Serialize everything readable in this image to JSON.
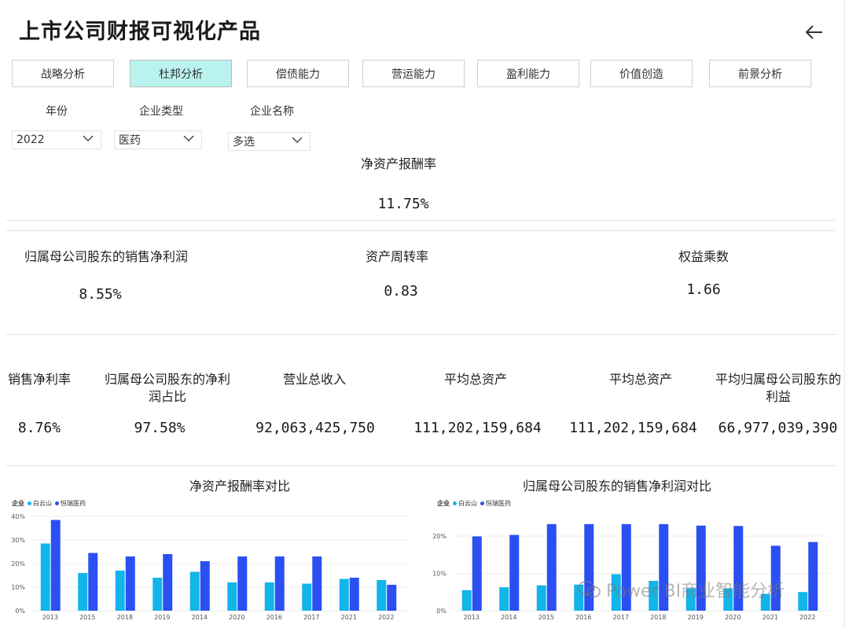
{
  "app": {
    "title": "上市公司财报可视化产品"
  },
  "tabs": [
    {
      "label": "战略分析",
      "active": false
    },
    {
      "label": "杜邦分析",
      "active": true
    },
    {
      "label": "偿债能力",
      "active": false
    },
    {
      "label": "营运能力",
      "active": false
    },
    {
      "label": "盈利能力",
      "active": false
    },
    {
      "label": "价值创造",
      "active": false
    },
    {
      "label": "前景分析",
      "active": false
    }
  ],
  "filters": {
    "year": {
      "label": "年份",
      "value": "2022"
    },
    "type": {
      "label": "企业类型",
      "value": "医药"
    },
    "name": {
      "label": "企业名称",
      "value": "多选"
    }
  },
  "kpis": {
    "roe": {
      "label": "净资产报酬率",
      "value": "11.75%"
    },
    "net_margin_parent": {
      "label": "归属母公司股东的销售净利润",
      "value": "8.55%"
    },
    "asset_turnover": {
      "label": "资产周转率",
      "value": "0.83"
    },
    "equity_multiplier": {
      "label": "权益乘数",
      "value": "1.66"
    },
    "net_margin": {
      "label": "销售净利率",
      "value": "8.76%"
    },
    "parent_profit_share": {
      "label": "归属母公司股东的净利润占比",
      "value": "97.58%"
    },
    "revenue": {
      "label": "营业总收入",
      "value": "92,063,425,750"
    },
    "avg_assets_1": {
      "label": "平均总资产",
      "value": "111,202,159,684"
    },
    "avg_assets_2": {
      "label": "平均总资产",
      "value": "111,202,159,684"
    },
    "avg_parent_equity": {
      "label": "平均归属母公司股东的利益",
      "value": "66,977,039,390"
    }
  },
  "colors": {
    "series_a": "#12b5ea",
    "series_b": "#2b4ff0",
    "active_tab": "#b9f2ef"
  },
  "chart_data": [
    {
      "type": "bar",
      "title": "净资产报酬率对比",
      "legend_title": "企业",
      "legend_position": "top-left",
      "grid": true,
      "categories": [
        "2013",
        "2015",
        "2018",
        "2019",
        "2014",
        "2020",
        "2016",
        "2017",
        "2021",
        "2022"
      ],
      "yticks": [
        "0%",
        "10%",
        "20%",
        "30%",
        "40%"
      ],
      "ylim": [
        0,
        40
      ],
      "series": [
        {
          "name": "白云山",
          "values": [
            28.5,
            16,
            17,
            14,
            16.5,
            12,
            12,
            11.5,
            13.5,
            13
          ]
        },
        {
          "name": "恒瑞医药",
          "values": [
            38.5,
            24.5,
            23,
            24,
            21,
            23,
            23,
            23,
            14,
            11
          ]
        }
      ]
    },
    {
      "type": "bar",
      "title": "归属母公司股东的销售净利润对比",
      "legend_title": "企业",
      "legend_position": "top-left",
      "grid": true,
      "categories": [
        "2013",
        "2014",
        "2015",
        "2016",
        "2017",
        "2018",
        "2019",
        "2020",
        "2021",
        "2022"
      ],
      "yticks": [
        "0%",
        "10%",
        "20%"
      ],
      "ylim": [
        0,
        24
      ],
      "series": [
        {
          "name": "白云山",
          "values": [
            5.5,
            6.3,
            6.8,
            7,
            9.8,
            8,
            6,
            6,
            4.5,
            5
          ]
        },
        {
          "name": "恒瑞医药",
          "values": [
            19.9,
            20.3,
            23.2,
            23.2,
            23.2,
            23.2,
            22.8,
            22.7,
            17.4,
            18.4
          ]
        }
      ]
    }
  ],
  "watermark": {
    "text": "Power BI商业智能分析"
  }
}
